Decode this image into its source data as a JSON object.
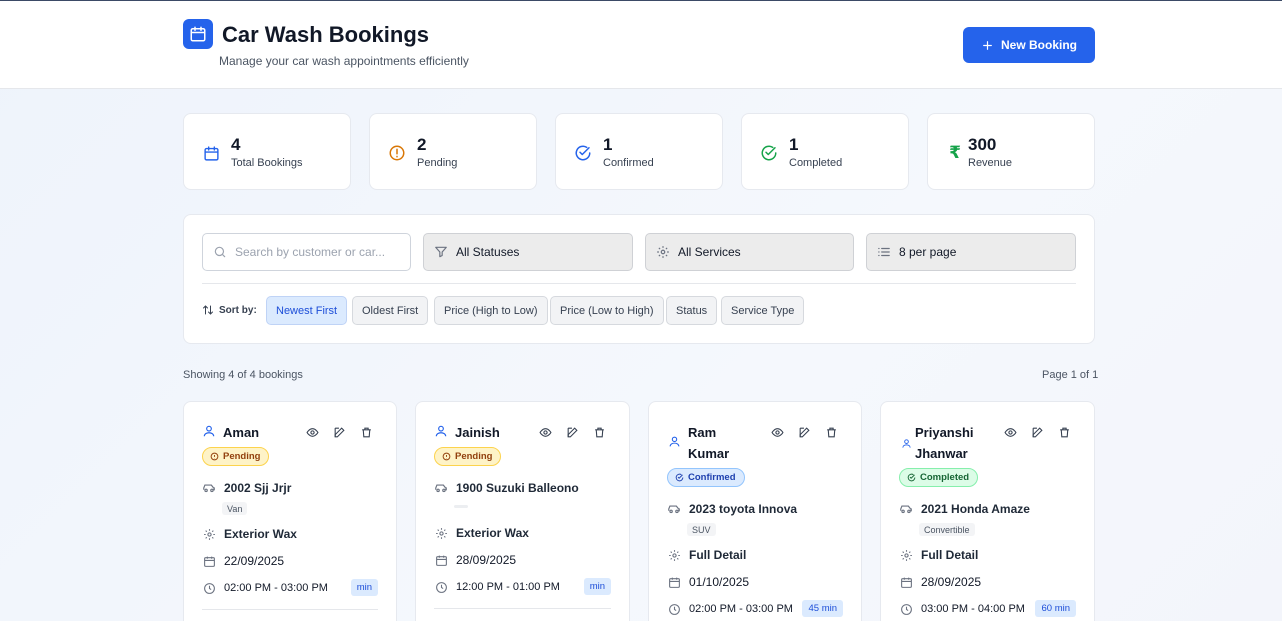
{
  "header": {
    "title": "Car Wash Bookings",
    "subtitle": "Manage your car wash appointments efficiently",
    "new_booking_label": "New Booking"
  },
  "stats": [
    {
      "value": "4",
      "label": "Total Bookings",
      "icon": "calendar-icon",
      "color": "#2563eb"
    },
    {
      "value": "2",
      "label": "Pending",
      "icon": "alert-circle-icon",
      "color": "#d97706"
    },
    {
      "value": "1",
      "label": "Confirmed",
      "icon": "check-circle-icon",
      "color": "#2563eb"
    },
    {
      "value": "1",
      "label": "Completed",
      "icon": "check-circle-icon",
      "color": "#16a34a"
    },
    {
      "value": "300",
      "label": "Revenue",
      "icon": "rupee-icon",
      "color": "#16a34a"
    }
  ],
  "filters": {
    "search_placeholder": "Search by customer or car...",
    "status": "All Statuses",
    "service": "All Services",
    "per_page": "8 per page",
    "sort_label": "Sort by:",
    "sort_options": [
      "Newest First",
      "Oldest First",
      "Price (High to Low)",
      "Price (Low to High)",
      "Status",
      "Service Type"
    ],
    "active_sort": "Newest First"
  },
  "summary": {
    "showing": "Showing 4 of 4 bookings",
    "page": "Page 1 of 1"
  },
  "bookings": [
    {
      "name": "Aman",
      "status": "Pending",
      "car": "2002 Sjj Jrjr",
      "type": "Van",
      "service": "Exterior Wax",
      "date": "22/09/2025",
      "time": "02:00 PM - 03:00 PM",
      "duration": "min"
    },
    {
      "name": "Jainish",
      "status": "Pending",
      "car": "1900 Suzuki Balleono",
      "type": "",
      "service": "Exterior Wax",
      "date": "28/09/2025",
      "time": "12:00 PM - 01:00 PM",
      "duration": "min"
    },
    {
      "name": "Ram Kumar",
      "status": "Confirmed",
      "car": "2023 toyota Innova",
      "type": "SUV",
      "service": "Full Detail",
      "date": "01/10/2025",
      "time": "02:00 PM - 03:00 PM",
      "duration": "45 min"
    },
    {
      "name": "Priyanshi Jhanwar",
      "status": "Completed",
      "car": "2021 Honda Amaze",
      "type": "Convertible",
      "service": "Full Detail",
      "date": "28/09/2025",
      "time": "03:00 PM - 04:00 PM",
      "duration": "60 min"
    }
  ],
  "colors": {
    "accent": "#2563eb",
    "pending": "#fef3c7",
    "confirmed": "#dbeafe",
    "completed": "#dcfce7"
  }
}
